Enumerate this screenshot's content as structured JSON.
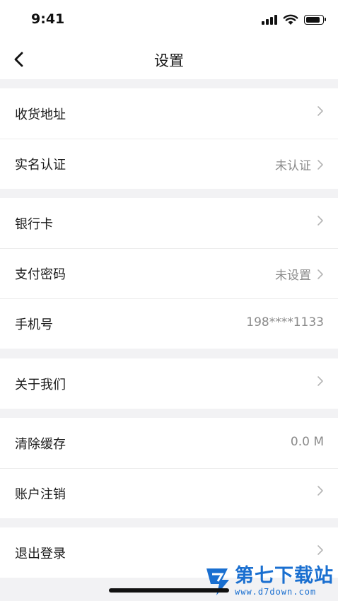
{
  "status_bar": {
    "time": "9:41"
  },
  "nav": {
    "title": "设置"
  },
  "groups": [
    {
      "items": [
        {
          "label": "收货地址",
          "value": ""
        },
        {
          "label": "实名认证",
          "value": "未认证"
        }
      ]
    },
    {
      "items": [
        {
          "label": "银行卡",
          "value": ""
        },
        {
          "label": "支付密码",
          "value": "未设置"
        },
        {
          "label": "手机号",
          "value": "198****1133"
        }
      ]
    },
    {
      "items": [
        {
          "label": "关于我们",
          "value": ""
        }
      ]
    },
    {
      "items": [
        {
          "label": "清除缓存",
          "value": "0.0 M"
        },
        {
          "label": "账户注销",
          "value": ""
        }
      ]
    },
    {
      "items": [
        {
          "label": "退出登录",
          "value": ""
        }
      ]
    }
  ],
  "watermark": {
    "title": "第七下载站",
    "url": "www.d7down.com"
  }
}
